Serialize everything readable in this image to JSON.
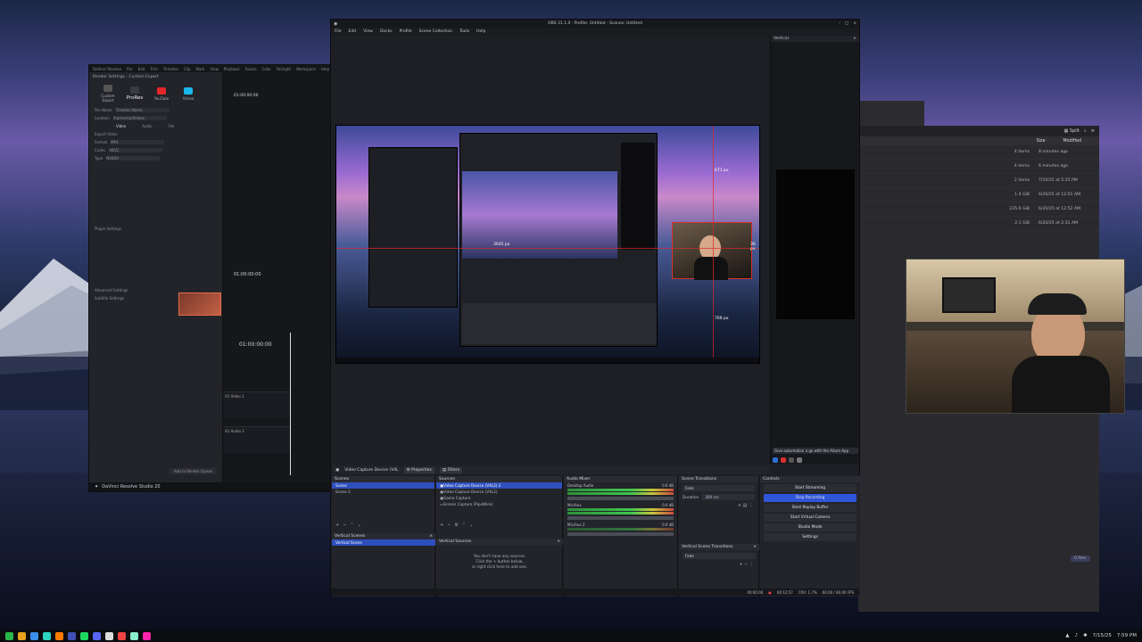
{
  "davinci": {
    "menu": [
      "DaVinci Resolve",
      "File",
      "Edit",
      "Trim",
      "Timeline",
      "Clip",
      "Mark",
      "View",
      "Playback",
      "Fusion",
      "Color",
      "Fairlight",
      "Workspace",
      "Help"
    ],
    "panel_title": "Render Settings - Custom Export",
    "presets": [
      "Custom Export",
      "ProRes",
      "YouTube",
      "Vimeo"
    ],
    "preset_active": "ProRes",
    "fields": [
      {
        "label": "File Name",
        "value": "Timeline Name"
      },
      {
        "label": "Location",
        "value": "/home/me/Videos"
      },
      {
        "label": "Format",
        "value": "MP4"
      },
      {
        "label": "Codec",
        "value": "HEVC"
      },
      {
        "label": "Type",
        "value": "NVIDIA"
      }
    ],
    "tabs": [
      "Video",
      "Audio",
      "File"
    ],
    "sections": [
      "Export Video",
      "Plugin Settings",
      "Advanced Settings",
      "Subtitle Settings"
    ],
    "timecode_top": "01:00:00:00",
    "timecode_mid": "01:00:00:00",
    "timecode_bottom": "01:00:00:00",
    "tracks": [
      {
        "id": "V1",
        "name": "Video 1"
      },
      {
        "id": "A1",
        "name": "Audio 1"
      }
    ],
    "add_queue": "Add to Render Queue",
    "footer": "DaVinci Resolve Studio 20"
  },
  "obs": {
    "title": "OBS 31.1.0 - Profile: Untitled - Scenes: Untitled",
    "menu": [
      "File",
      "Edit",
      "View",
      "Docks",
      "Profile",
      "Scene Collection",
      "Tools",
      "Help"
    ],
    "vertical_panel_title": "Vertical",
    "vertical_tip": "Give automation a go with the Aitum App",
    "measure_labels": [
      "3045 px",
      "671 px",
      "766 px",
      "36 px"
    ],
    "source_bar": {
      "source": "Video Capture Device (V4L",
      "properties": "Properties",
      "filters": "Filters"
    },
    "scenes": {
      "title": "Scenes",
      "items": [
        "Scene",
        "Scene 2"
      ],
      "selected": 0
    },
    "vertical_scenes": {
      "title": "Vertical Scenes",
      "items": [
        "Vertical Scene"
      ],
      "selected": 0
    },
    "sources": {
      "title": "Sources",
      "items": [
        "Video Capture Device (V4L2) 2",
        "Video Capture Device (V4L2)",
        "Game Capture",
        "Screen Capture (PipeWire)"
      ],
      "selected": 0
    },
    "vertical_sources": {
      "title": "Vertical Sources",
      "empty": [
        "You don't have any sources.",
        "Click the + button below,",
        "or right click here to add one."
      ]
    },
    "audio_mixer": {
      "title": "Audio Mixer",
      "channels": [
        {
          "name": "Desktop Audio",
          "db": "0.0 dB"
        },
        {
          "name": "Mic/Aux",
          "db": "0.0 dB"
        },
        {
          "name": "Mic/Aux 2",
          "db": "0.0 dB"
        }
      ]
    },
    "transitions": {
      "title": "Scene Transitions",
      "type": "Fade",
      "duration_label": "Duration",
      "duration": "300 ms"
    },
    "vertical_transitions": {
      "title": "Vertical Scene Transitions",
      "type": "Fade"
    },
    "controls": {
      "title": "Controls",
      "buttons": [
        "Start Streaming",
        "Stop Recording",
        "Start Replay Buffer",
        "Start Virtual Camera",
        "Studio Mode",
        "Settings"
      ],
      "active": "Stop Recording"
    },
    "status": {
      "rec_time": "00:12:57",
      "cpu": "CPU: 1.7%",
      "fps": "60.00 / 60.00 FPS",
      "stream_time": "00:00:00"
    }
  },
  "files": {
    "split_label": "Split",
    "columns": {
      "size": "Size",
      "modified": "Modified"
    },
    "rows": [
      {
        "size": "4 items",
        "modified": "8 minutes ago"
      },
      {
        "size": "4 items",
        "modified": "6 minutes ago"
      },
      {
        "size": "2 items",
        "modified": "7/10/25 at 5:25 PM"
      },
      {
        "size": "1.4 GiB",
        "modified": "6/20/25 at 12:01 AM"
      },
      {
        "size": "235.6 GiB",
        "modified": "6/20/25 at 12:52 AM"
      },
      {
        "size": "2.1 GiB",
        "modified": "6/20/25 at 2:31 AM"
      }
    ],
    "free_label": "0 files"
  },
  "taskbar": {
    "date": "7/15/25",
    "time": "7:59 PM",
    "icon_colors": [
      "#2bb64a",
      "#e8a21b",
      "#3a8ee6",
      "#2dd4bf",
      "#ff7a00",
      "#3f51b5",
      "#1ed760",
      "#5865f2",
      "#e44",
      "#8ec",
      "#ddd",
      "#f2a"
    ]
  }
}
